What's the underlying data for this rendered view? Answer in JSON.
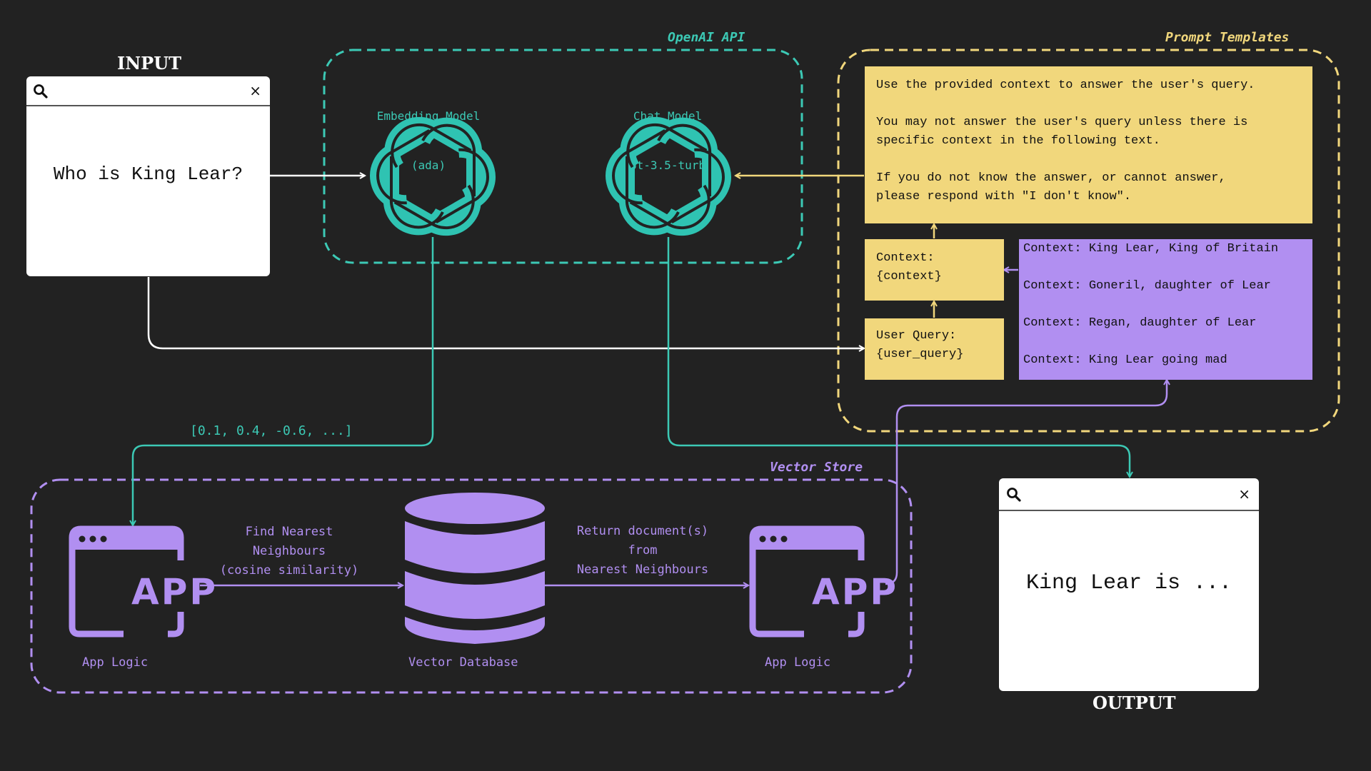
{
  "colors": {
    "background": "#222222",
    "teal": "#3cc9b5",
    "yellow": "#f1d77c",
    "purple": "#b18ff1",
    "white": "#ffffff"
  },
  "input": {
    "title": "INPUT",
    "query_text": "Who is King Lear?",
    "search_icon": "search-icon",
    "close_symbol": "×"
  },
  "output": {
    "title": "OUTPUT",
    "answer_text": "King Lear is ...",
    "search_icon": "search-icon",
    "close_symbol": "×"
  },
  "openai_api": {
    "title": "OpenAI API",
    "embedding_model": {
      "name": "Embedding Model",
      "variant": "(ada)",
      "icon": "openai-logo-icon"
    },
    "chat_model": {
      "name": "Chat Model",
      "variant": "(gpt-3.5-turbo)",
      "icon": "openai-logo-icon"
    }
  },
  "prompt_templates": {
    "title": "Prompt Templates",
    "system_prompt": "Use the provided context to answer the user's query.\n\nYou may not answer the user's query unless there is\nspecific context in the following text.\n\nIf you do not know the answer, or cannot answer,\nplease respond with \"I don't know\".",
    "context_template": "Context:\n{context}",
    "user_query_template": "User Query:\n{user_query}",
    "context_items": [
      "Context: King Lear, King of Britain",
      "Context: Goneril, daughter of Lear",
      "Context: Regan, daughter of Lear",
      "Context: King Lear going mad"
    ]
  },
  "vector_store": {
    "title": "Vector Store",
    "embedding_vector": "[0.1, 0.4, -0.6, ...]",
    "app_logic_left": {
      "label": "App Logic",
      "icon_text": "APP",
      "icon": "app-window-icon"
    },
    "app_logic_right": {
      "label": "App Logic",
      "icon_text": "APP",
      "icon": "app-window-icon"
    },
    "vector_database": {
      "label": "Vector Database",
      "icon": "database-icon"
    },
    "find_label": "Find Nearest\nNeighbours\n(cosine similarity)",
    "return_label": "Return document(s)\nfrom\nNearest Neighbours"
  }
}
